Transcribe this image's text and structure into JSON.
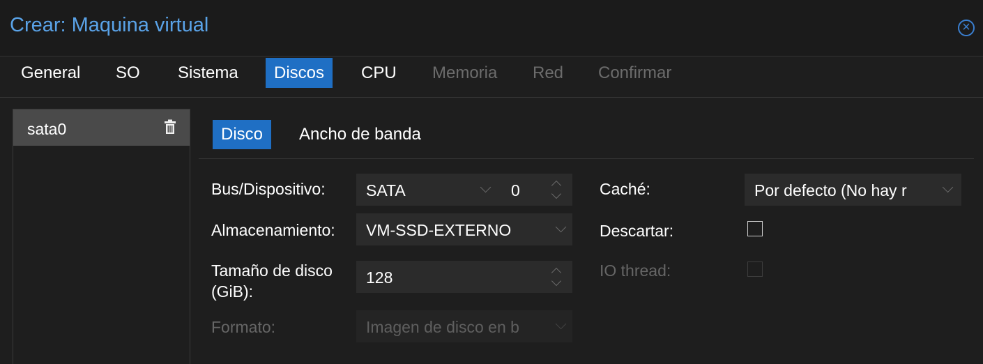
{
  "window": {
    "title": "Crear: Maquina virtual"
  },
  "tabs": [
    {
      "label": "General",
      "state": "normal"
    },
    {
      "label": "SO",
      "state": "normal"
    },
    {
      "label": "Sistema",
      "state": "normal"
    },
    {
      "label": "Discos",
      "state": "active"
    },
    {
      "label": "CPU",
      "state": "normal"
    },
    {
      "label": "Memoria",
      "state": "disabled"
    },
    {
      "label": "Red",
      "state": "disabled"
    },
    {
      "label": "Confirmar",
      "state": "disabled"
    }
  ],
  "disk_list": {
    "items": [
      {
        "label": "sata0"
      }
    ]
  },
  "subtabs": [
    {
      "label": "Disco",
      "state": "active"
    },
    {
      "label": "Ancho de banda",
      "state": "normal"
    }
  ],
  "form": {
    "bus_label": "Bus/Dispositivo:",
    "bus_value": "SATA",
    "device_value": "0",
    "storage_label": "Almacenamiento:",
    "storage_value": "VM-SSD-EXTERNO",
    "size_label_line1": "Tamaño de disco",
    "size_label_line2": "(GiB):",
    "size_value": "128",
    "format_label": "Formato:",
    "format_value": "Imagen de disco en b",
    "cache_label": "Caché:",
    "cache_value": "Por defecto (No hay r",
    "discard_label": "Descartar:",
    "discard_checked": false,
    "iothread_label": "IO thread:",
    "iothread_checked": false
  },
  "colors": {
    "accent": "#1f6fc4",
    "title": "#5aa3e8",
    "background": "#1e1e1e"
  }
}
